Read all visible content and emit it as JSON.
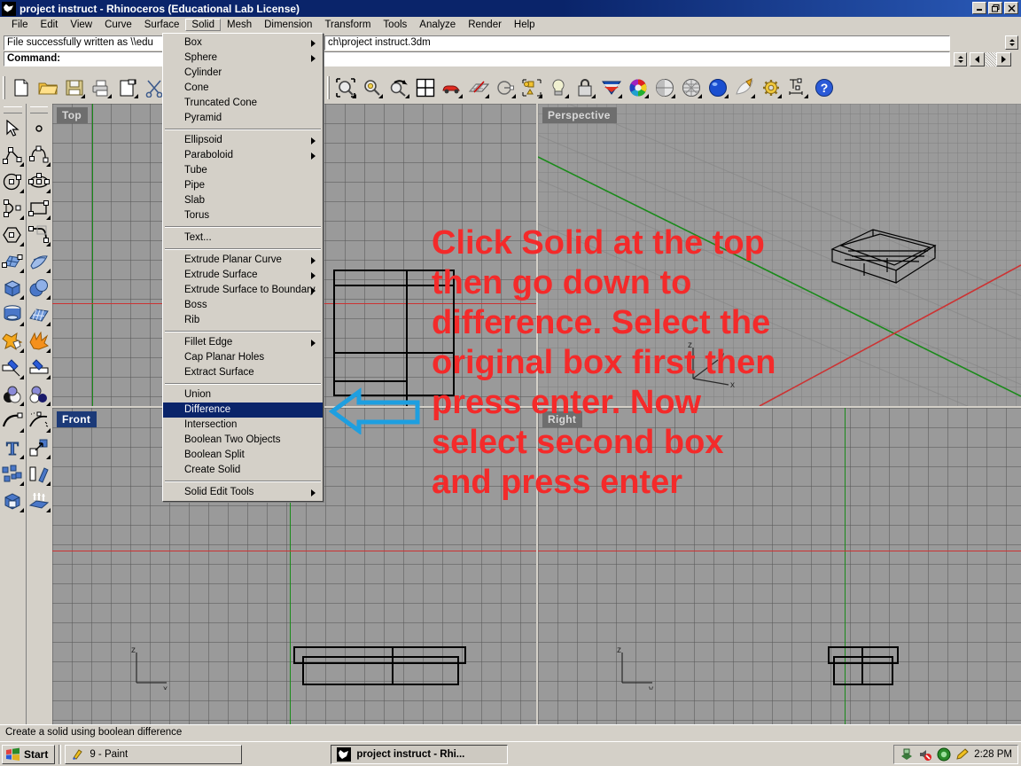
{
  "window": {
    "title": "project instruct - Rhinoceros (Educational Lab License)",
    "icon": "rhino-icon",
    "minimize": "_",
    "maximize": "❐",
    "close": "✕"
  },
  "menubar": {
    "items": [
      {
        "label": "File"
      },
      {
        "label": "Edit"
      },
      {
        "label": "View"
      },
      {
        "label": "Curve"
      },
      {
        "label": "Surface"
      },
      {
        "label": "Solid",
        "open": true
      },
      {
        "label": "Mesh"
      },
      {
        "label": "Dimension"
      },
      {
        "label": "Transform"
      },
      {
        "label": "Tools"
      },
      {
        "label": "Analyze"
      },
      {
        "label": "Render"
      },
      {
        "label": "Help"
      }
    ]
  },
  "command_area": {
    "history_line": "File successfully written as \\\\edu",
    "history_line_tail": "ch\\project instruct.3dm",
    "prompt": "Command:"
  },
  "toolbar": {
    "left_group": [
      "new-file-icon",
      "open-folder-icon",
      "save-disk-icon",
      "print-icon",
      "copy-page-icon",
      "scissors-cut-icon"
    ],
    "right_group": [
      "zoom-extents-icon",
      "zoom-window-icon",
      "undo-view-icon",
      "viewport-layout-icon",
      "car-icon",
      "grid-plane-icon",
      "circle-dot-icon",
      "properties-icon",
      "light-bulb-icon",
      "lock-icon",
      "render-color-icon",
      "color-wheel-icon",
      "shade-sphere-icon",
      "wireframe-sphere-icon",
      "render-preview-icon",
      "flat-shade-icon",
      "gear-render-icon",
      "dimension-icon",
      "help-icon"
    ]
  },
  "left_toolbar": {
    "column1": [
      "select-arrow-icon",
      "polyline-icon",
      "circle-icon",
      "arc-icon",
      "polygon-icon",
      "surface-patch-icon",
      "box-icon",
      "cylinder-icon",
      "boolean-star-icon",
      "split-icon",
      "boolean-union-icon",
      "curve-tools-icon",
      "text-icon",
      "select-objects-icon",
      "solid-tools-icon"
    ],
    "column2": [
      "point-icon",
      "curve-control-icon",
      "ellipse-icon",
      "rectangle-icon",
      "curve-line-icon",
      "surface-sweep-icon",
      "sphere-icon",
      "surface-grid-icon",
      "explode-burst-icon",
      "trim-icon",
      "boolean-spheres-icon",
      "curve-fit-icon",
      "scale-arrow-icon",
      "rotate-copy-icon",
      "extrude-up-icon"
    ]
  },
  "solid_menu": {
    "sections": [
      [
        {
          "label": "Box",
          "submenu": true
        },
        {
          "label": "Sphere",
          "submenu": true
        },
        {
          "label": "Cylinder",
          "submenu": false
        },
        {
          "label": "Cone",
          "submenu": false
        },
        {
          "label": "Truncated Cone",
          "submenu": false
        },
        {
          "label": "Pyramid",
          "submenu": false
        }
      ],
      [
        {
          "label": "Ellipsoid",
          "submenu": true
        },
        {
          "label": "Paraboloid",
          "submenu": true
        },
        {
          "label": "Tube",
          "submenu": false
        },
        {
          "label": "Pipe",
          "submenu": false
        },
        {
          "label": "Slab",
          "submenu": false
        },
        {
          "label": "Torus",
          "submenu": false
        }
      ],
      [
        {
          "label": "Text...",
          "submenu": false
        }
      ],
      [
        {
          "label": "Extrude Planar Curve",
          "submenu": true
        },
        {
          "label": "Extrude Surface",
          "submenu": true
        },
        {
          "label": "Extrude Surface to Boundary",
          "submenu": true
        },
        {
          "label": "Boss",
          "submenu": false
        },
        {
          "label": "Rib",
          "submenu": false
        }
      ],
      [
        {
          "label": "Fillet Edge",
          "submenu": true
        },
        {
          "label": "Cap Planar Holes",
          "submenu": false
        },
        {
          "label": "Extract Surface",
          "submenu": false
        }
      ],
      [
        {
          "label": "Union",
          "submenu": false
        },
        {
          "label": "Difference",
          "submenu": false,
          "selected": true
        },
        {
          "label": "Intersection",
          "submenu": false
        },
        {
          "label": "Boolean Two Objects",
          "submenu": false
        },
        {
          "label": "Boolean Split",
          "submenu": false
        },
        {
          "label": "Create Solid",
          "submenu": false
        }
      ],
      [
        {
          "label": "Solid Edit Tools",
          "submenu": true
        }
      ]
    ]
  },
  "viewports": [
    {
      "name": "Top",
      "label": "Top",
      "active": false
    },
    {
      "name": "Perspective",
      "label": "Perspective",
      "active": false
    },
    {
      "name": "Front",
      "label": "Front",
      "active": true
    },
    {
      "name": "Right",
      "label": "Right",
      "active": false
    }
  ],
  "annotation": {
    "color": "#f42a2a",
    "lines": [
      "Click Solid at the top",
      "then go down to",
      "difference.  Select the",
      "original box first then",
      "press enter.  Now",
      "select second box",
      "and press enter"
    ],
    "arrow": "left-arrow-annotation",
    "arrow_color": "#1e9fe0"
  },
  "statusbar": {
    "text": "Create a solid using boolean difference"
  },
  "taskbar": {
    "start_label": "Start",
    "start_icon": "windows-flag-icon",
    "tasks": [
      {
        "label": "9 - Paint",
        "icon": "paint-icon",
        "active": false
      },
      {
        "label": "project instruct - Rhi...",
        "icon": "rhino-icon",
        "active": true
      }
    ],
    "tray_icons": [
      "network-icon",
      "volume-mute-icon",
      "shield-icon",
      "pencil-icon"
    ],
    "clock": "2:28 PM"
  }
}
